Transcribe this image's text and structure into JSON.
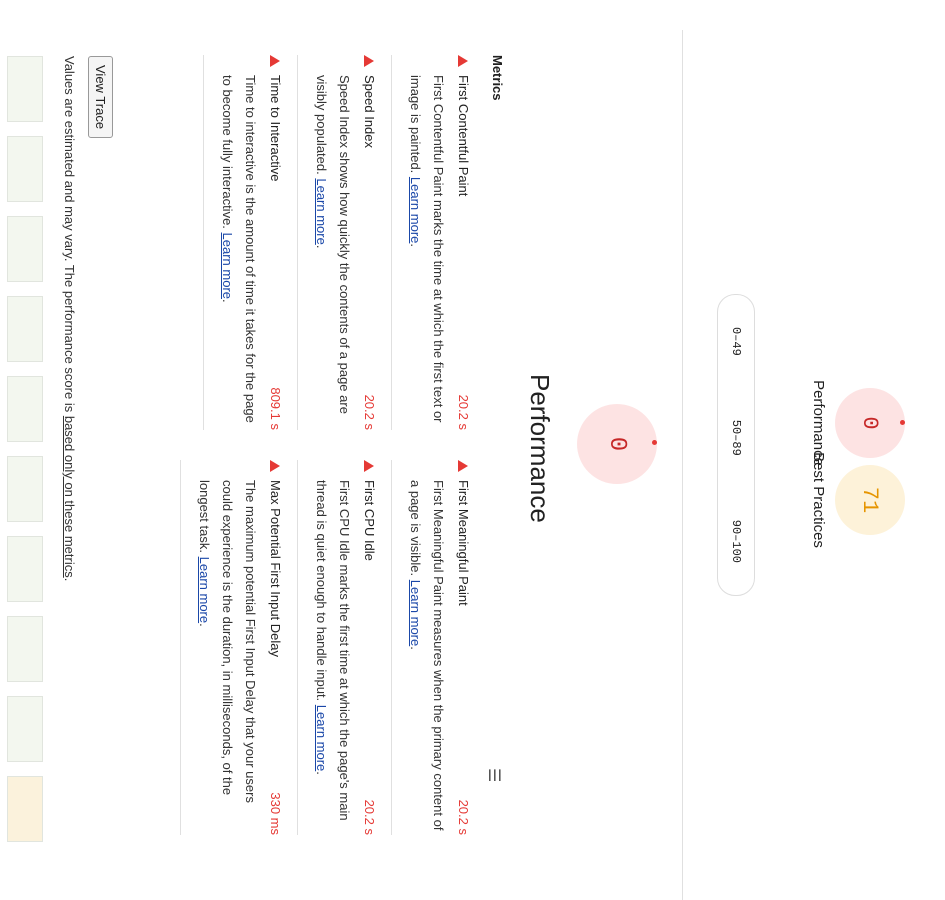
{
  "gauges": [
    {
      "label": "Performance",
      "score": "0"
    },
    {
      "label": "Best Practices",
      "score": "71"
    }
  ],
  "legend": [
    "0–49",
    "50–89",
    "90–100"
  ],
  "performance": {
    "score": "0",
    "title": "Performance"
  },
  "menu_icon": "menu-icon",
  "metrics_title": "Metrics",
  "metrics_left": [
    {
      "name": "First Contentful Paint",
      "value": "20.2 s",
      "desc": "First Contentful Paint marks the time at which the first text or image is painted.",
      "link": "Learn more"
    },
    {
      "name": "Speed Index",
      "value": "20.2 s",
      "desc": "Speed Index shows how quickly the contents of a page are visibly populated.",
      "link": "Learn more"
    },
    {
      "name": "Time to Interactive",
      "value": "809.1 s",
      "desc": "Time to interactive is the amount of time it takes for the page to become fully interactive.",
      "link": "Learn more"
    }
  ],
  "metrics_right": [
    {
      "name": "First Meaningful Paint",
      "value": "20.2 s",
      "desc": "First Meaningful Paint measures when the primary content of a page is visible.",
      "link": "Learn more"
    },
    {
      "name": "First CPU Idle",
      "value": "20.2 s",
      "desc": "First CPU Idle marks the first time at which the page's main thread is quiet enough to handle input.",
      "link": "Learn more"
    },
    {
      "name": "Max Potential First Input Delay",
      "value": "330 ms",
      "desc": "The maximum potential First Input Delay that your users could experience is the duration, in milliseconds, of the longest task.",
      "link": "Learn more"
    }
  ],
  "view_trace": "View Trace",
  "note_pre": "Values are estimated and may vary. The performance score is ",
  "note_link": "based only on these metrics",
  "note_post": "."
}
